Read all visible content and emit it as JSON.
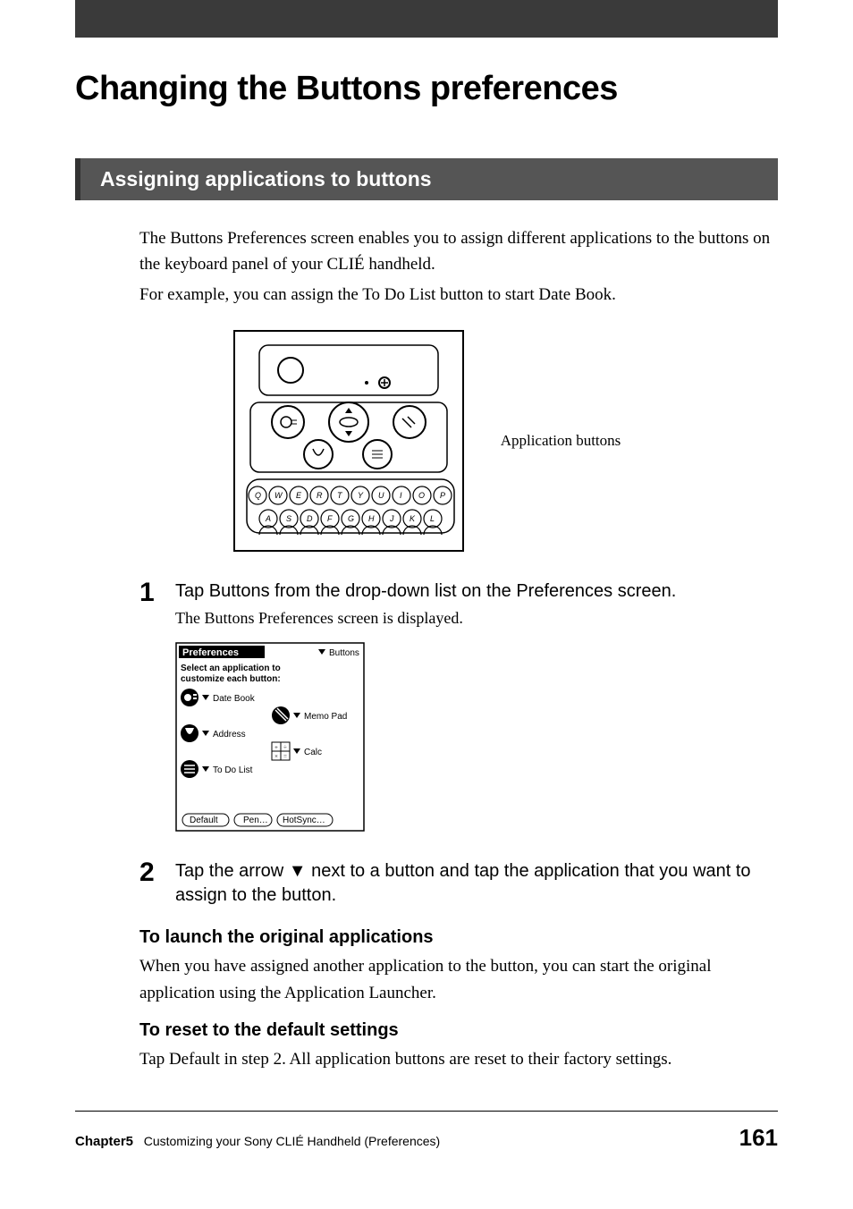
{
  "title": "Changing the Buttons preferences",
  "section_title": "Assigning applications to buttons",
  "intro_p1": "The Buttons Preferences screen enables you to assign different applications to the buttons on the keyboard panel of your CLIÉ handheld.",
  "intro_p2": "For example, you can assign the To Do List button to start Date Book.",
  "figure_callout": "Application buttons",
  "steps": [
    {
      "num": "1",
      "title": "Tap Buttons from the drop-down list on the Preferences screen.",
      "sub": "The Buttons Preferences screen is displayed."
    },
    {
      "num": "2",
      "title": "Tap the arrow V next to a button and tap the application that you want to assign to the button."
    }
  ],
  "screenshot": {
    "header": "Preferences",
    "dropdown": "Buttons",
    "instruction": "Select an application to customize each button:",
    "items": [
      "Date Book",
      "Memo Pad",
      "Address",
      "Calc",
      "To Do List"
    ],
    "buttons": [
      "Default",
      "Pen…",
      "HotSync…"
    ]
  },
  "sub_sections": [
    {
      "heading": "To launch the original applications",
      "body": "When you have assigned another application to the button, you can start the original application using the Application Launcher."
    },
    {
      "heading": "To reset to the default settings",
      "body": "Tap Default in step 2. All application buttons are reset to their factory settings."
    }
  ],
  "footer": {
    "chapter_label": "Chapter5",
    "chapter_title": "Customizing your Sony CLIÉ Handheld (Preferences)",
    "page": "161"
  }
}
